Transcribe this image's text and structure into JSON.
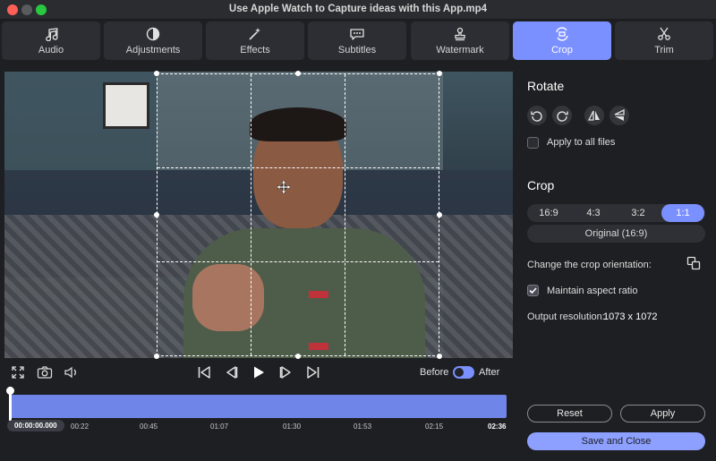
{
  "window": {
    "title": "Use Apple Watch to Capture ideas with this App.mp4"
  },
  "tabs": [
    {
      "label": "Audio",
      "icon": "music-note-icon"
    },
    {
      "label": "Adjustments",
      "icon": "contrast-icon"
    },
    {
      "label": "Effects",
      "icon": "magic-wand-icon"
    },
    {
      "label": "Subtitles",
      "icon": "speech-bubble-icon"
    },
    {
      "label": "Watermark",
      "icon": "stamp-icon"
    },
    {
      "label": "Crop",
      "icon": "crop-rotate-icon",
      "active": true
    },
    {
      "label": "Trim",
      "icon": "scissors-icon"
    }
  ],
  "player": {
    "before_label": "Before",
    "after_label": "After",
    "compare_toggle_on": true
  },
  "timeline": {
    "current_time": "00:00:00.000",
    "marks": [
      "00:22",
      "00:45",
      "01:07",
      "01:30",
      "01:53",
      "02:15"
    ],
    "end_time": "02:36"
  },
  "panel": {
    "rotate_heading": "Rotate",
    "apply_all_label": "Apply to all files",
    "apply_all_checked": false,
    "crop_heading": "Crop",
    "ratios": [
      "16:9",
      "4:3",
      "3:2",
      "1:1"
    ],
    "active_ratio": "1:1",
    "original_label": "Original (16:9)",
    "orientation_label": "Change the crop orientation:",
    "maintain_label": "Maintain aspect ratio",
    "maintain_checked": true,
    "resolution_label": "Output resolution:",
    "resolution_value": "1073 x 1072",
    "reset_label": "Reset",
    "apply_label": "Apply",
    "save_label": "Save and Close"
  },
  "colors": {
    "accent": "#7b90ff",
    "background": "#1e1f22",
    "tab_bg": "#2d2e33"
  }
}
